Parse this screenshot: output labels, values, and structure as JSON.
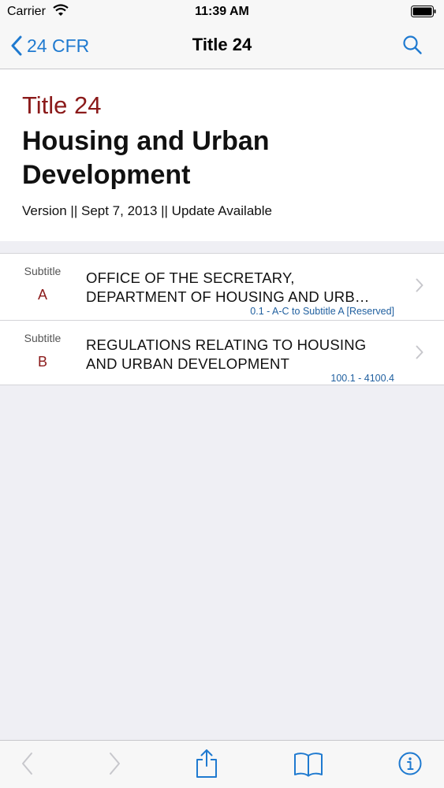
{
  "status_bar": {
    "carrier": "Carrier",
    "time": "11:39 AM"
  },
  "nav": {
    "back_label": "24 CFR",
    "title": "Title 24"
  },
  "header": {
    "title_number": "Title 24",
    "title_name": "Housing and Urban Development",
    "version_line": "Version || Sept 7, 2013 || Update Available"
  },
  "subtitles": [
    {
      "label": "Subtitle",
      "letter": "A",
      "title_line1": "OFFICE OF THE SECRETARY,",
      "title_line2": "DEPARTMENT OF HOUSING AND URB…",
      "range": "0.1 - A-C to Subtitle A [Reserved]"
    },
    {
      "label": "Subtitle",
      "letter": "B",
      "title_line1": "REGULATIONS RELATING TO HOUSING",
      "title_line2": "AND URBAN DEVELOPMENT",
      "range": "100.1 - 4100.4"
    }
  ],
  "colors": {
    "accent": "#1f7ad0",
    "title_red": "#8b1a1a",
    "range_blue": "#1f5f9f"
  },
  "icons": {
    "back": "chevron-left-icon",
    "search": "search-icon",
    "row": "chevron-right-icon",
    "toolbar": [
      "back-arrow-icon",
      "forward-arrow-icon",
      "share-icon",
      "book-icon",
      "info-icon"
    ]
  }
}
